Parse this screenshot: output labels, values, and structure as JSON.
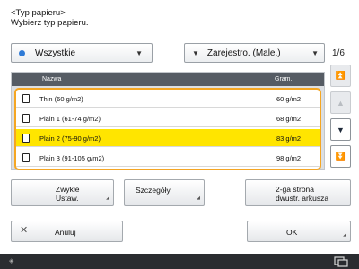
{
  "header": {
    "title": "<Typ papieru>",
    "subtitle": "Wybierz typ papieru."
  },
  "filters": {
    "category": "Wszystkie",
    "sort": "Zarejestro. (Male.)",
    "page_indicator": "1/6"
  },
  "list": {
    "columns": {
      "name": "Nazwa",
      "gram": "Gram."
    },
    "rows": [
      {
        "name": "Thin (60 g/m2)",
        "gram": "60 g/m2",
        "selected": false
      },
      {
        "name": "Plain 1 (61-74 g/m2)",
        "gram": "68 g/m2",
        "selected": false
      },
      {
        "name": "Plain 2 (75-90 g/m2)",
        "gram": "83 g/m2",
        "selected": true
      },
      {
        "name": "Plain 3 (91-105 g/m2)",
        "gram": "98 g/m2",
        "selected": false
      }
    ]
  },
  "buttons": {
    "zwykle_line1": "Zwykłe",
    "zwykle_line2": "Ustaw.",
    "details": "Szczegóły",
    "two_sided_line1": "2-ga strona",
    "two_sided_line2": "dwustr. arkusza",
    "cancel": "Anuluj",
    "ok": "OK"
  },
  "colors": {
    "selection": "#ffe500",
    "focus_border": "#f5a623",
    "header_bar": "#565c64"
  }
}
